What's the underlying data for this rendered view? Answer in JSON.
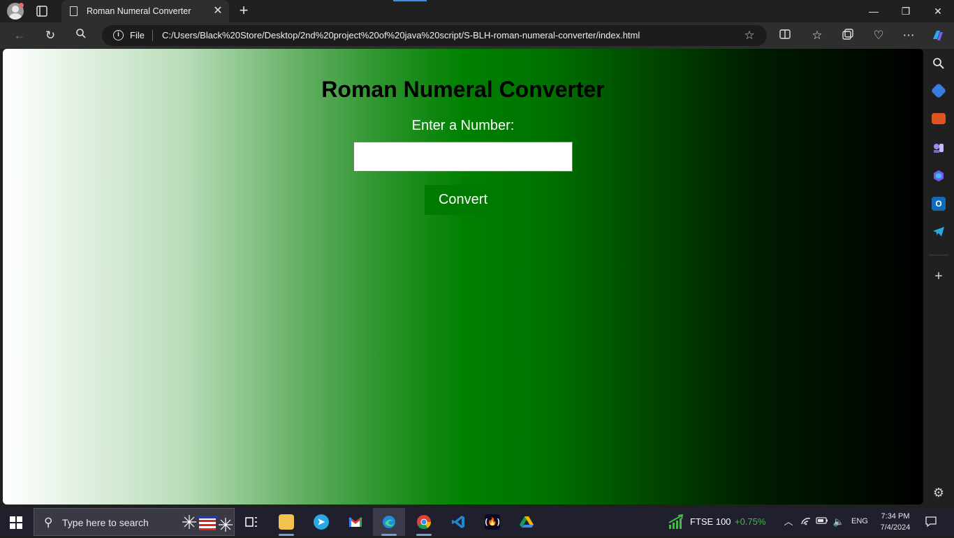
{
  "browser": {
    "tab_title": "Roman Numeral Converter",
    "tab_close": "✕",
    "new_tab": "+",
    "window_controls": {
      "minimize": "—",
      "restore": "❐",
      "close": "✕"
    },
    "address": {
      "scheme_label": "File",
      "url": "C:/Users/Black%20Store/Desktop/2nd%20project%20of%20java%20script/S-BLH-roman-numeral-converter/index.html"
    },
    "nav_icons": [
      "back-icon",
      "refresh-icon",
      "search-icon"
    ],
    "toolbar_icons": [
      "split-screen-icon",
      "favorites-icon",
      "collections-icon",
      "performance-icon",
      "more-icon",
      "copilot-icon"
    ]
  },
  "page": {
    "title": "Roman Numeral Converter",
    "label": "Enter a Number:",
    "input_value": "",
    "button_label": "Convert",
    "colors": {
      "button": "#007a00",
      "gradient_start": "#ffffff",
      "gradient_mid": "#008000",
      "gradient_end": "#000000"
    }
  },
  "sidebar": {
    "icons": [
      "search-icon",
      "shopping-icon",
      "tools-icon",
      "games-icon",
      "microsoft-365-icon",
      "outlook-icon",
      "telegram-icon",
      "add-icon",
      "settings-icon"
    ]
  },
  "taskbar": {
    "search_placeholder": "Type here to search",
    "apps": [
      "task-view",
      "file-explorer",
      "telegram",
      "gmail",
      "edge",
      "chrome",
      "vscode",
      "freecodecamp",
      "google-drive"
    ],
    "ticker_name": "FTSE 100",
    "ticker_change": "+0.75%",
    "language": "ENG",
    "time": "7:34 PM",
    "date": "7/4/2024"
  }
}
